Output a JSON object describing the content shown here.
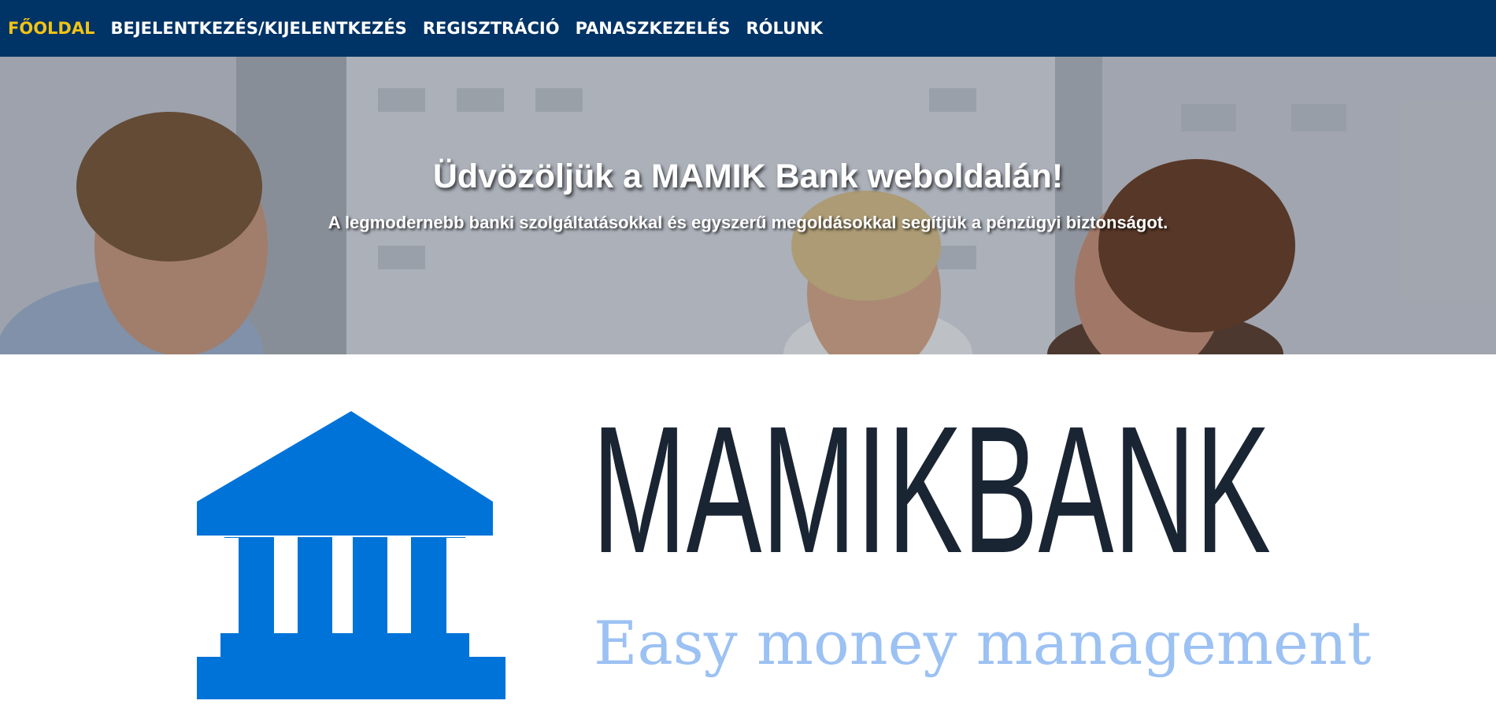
{
  "nav": {
    "items": [
      {
        "label": "FŐOLDAL",
        "active": true
      },
      {
        "label": "BEJELENTKEZÉS/KIJELENTKEZÉS",
        "active": false
      },
      {
        "label": "REGISZTRÁCIÓ",
        "active": false
      },
      {
        "label": "PANASZKEZELÉS",
        "active": false
      },
      {
        "label": "RÓLUNK",
        "active": false
      }
    ],
    "background": "#003366",
    "active_color": "#f2c316"
  },
  "hero": {
    "title": "Üdvözöljük a MAMIK Bank weboldalán!",
    "subtitle": "A legmodernebb banki szolgáltatásokkal és egyszerű megoldásokkal segítjük a pénzügyi biztonságot."
  },
  "brand": {
    "name": "MAMIKBANK",
    "tagline": "Easy money management",
    "icon": "bank-building-icon",
    "icon_color": "#0073d9",
    "name_color": "#1a2533",
    "tagline_color": "#9cc1f3"
  }
}
